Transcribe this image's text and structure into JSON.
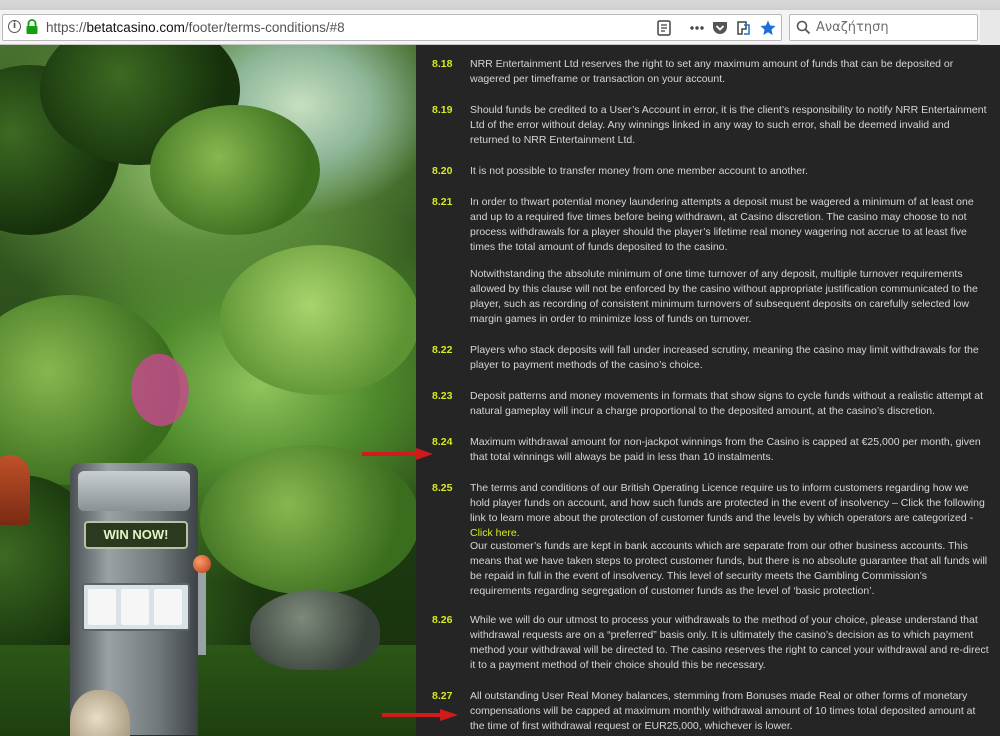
{
  "browser": {
    "url_prefix": "https://",
    "url_host": "betatcasino.com",
    "url_path": "/footer/terms-conditions/#8",
    "search_placeholder": "Αναζήτηση"
  },
  "background": {
    "slot_sign": "WIN NOW!"
  },
  "terms": [
    {
      "num": "8.18",
      "paras": [
        "NRR Entertainment Ltd reserves the right to set any maximum amount of funds that can be deposited or wagered per timeframe or transaction on your account."
      ]
    },
    {
      "num": "8.19",
      "paras": [
        "Should funds be credited to a User’s Account in error, it is the client’s responsibility to notify NRR Entertainment Ltd of the error without delay. Any winnings linked in any way to such error, shall be deemed invalid and returned to NRR Entertainment Ltd."
      ]
    },
    {
      "num": "8.20",
      "paras": [
        "It is not possible to transfer money from one member account to another."
      ]
    },
    {
      "num": "8.21",
      "paras": [
        "In order to thwart potential money laundering attempts a deposit must be wagered a minimum of at least one and up to a required five times before being withdrawn, at Casino discretion. The casino may choose to not process withdrawals for a player should the player’s lifetime real money wagering not accrue to at least five times the total amount of funds deposited to the casino.",
        "Notwithstanding the absolute minimum of one time turnover of any deposit, multiple turnover requirements allowed by this clause will not be enforced by the casino without appropriate justification communicated to the player, such as recording of consistent minimum turnovers of subsequent deposits on carefully selected low margin games in order to minimize loss of funds on turnover."
      ]
    },
    {
      "num": "8.22",
      "paras": [
        "Players who stack deposits will fall under increased scrutiny, meaning the casino may limit withdrawals for the player to payment methods of the casino’s choice."
      ]
    },
    {
      "num": "8.23",
      "paras": [
        "Deposit patterns and money movements in formats that show signs to cycle funds without a realistic attempt at natural gameplay will incur a charge proportional to the deposited amount, at the casino’s discretion."
      ]
    },
    {
      "num": "8.24",
      "paras": [
        "Maximum withdrawal amount for non-jackpot winnings from the Casino is capped at €25,000 per month, given that total winnings will always be paid in less than 10 instalments."
      ]
    },
    {
      "num": "8.25",
      "paras": [
        "The terms and conditions of our British Operating Licence require us to inform customers regarding how we hold player funds on account, and how such funds are protected in the event of insolvency – Click the following link to learn more about the protection of customer funds and the levels by which operators are categorized - ",
        "Our customer’s funds are kept in bank accounts which are separate from our other business accounts. This means that we have taken steps to protect customer funds, but there is no absolute guarantee that all funds will be repaid in full in the event of insolvency. This level of security meets the Gambling Commission’s requirements regarding segregation of customer funds as the level of ‘basic protection’."
      ],
      "link": "Click here"
    },
    {
      "num": "8.26",
      "paras": [
        "While we will do our utmost to process your withdrawals to the method of your choice, please understand that withdrawal requests are on a “preferred” basis only. It is ultimately the casino’s decision as to which payment method your withdrawal will be directed to. The casino reserves the right to cancel your withdrawal and re-direct it to a payment method of their choice should this be necessary."
      ]
    },
    {
      "num": "8.27",
      "paras": [
        "All outstanding User Real Money balances, stemming from Bonuses made Real or other forms of monetary compensations will be capped at maximum monthly withdrawal amount of 10 times total deposited amount at the time of first withdrawal request or EUR25,000, whichever is lower."
      ]
    }
  ],
  "colors": {
    "panel_bg": "#252525",
    "clause_number": "#d7ea22",
    "body_text": "#d6d6d6",
    "link": "#d7ea22",
    "annotation_arrow": "#d11a1a"
  }
}
